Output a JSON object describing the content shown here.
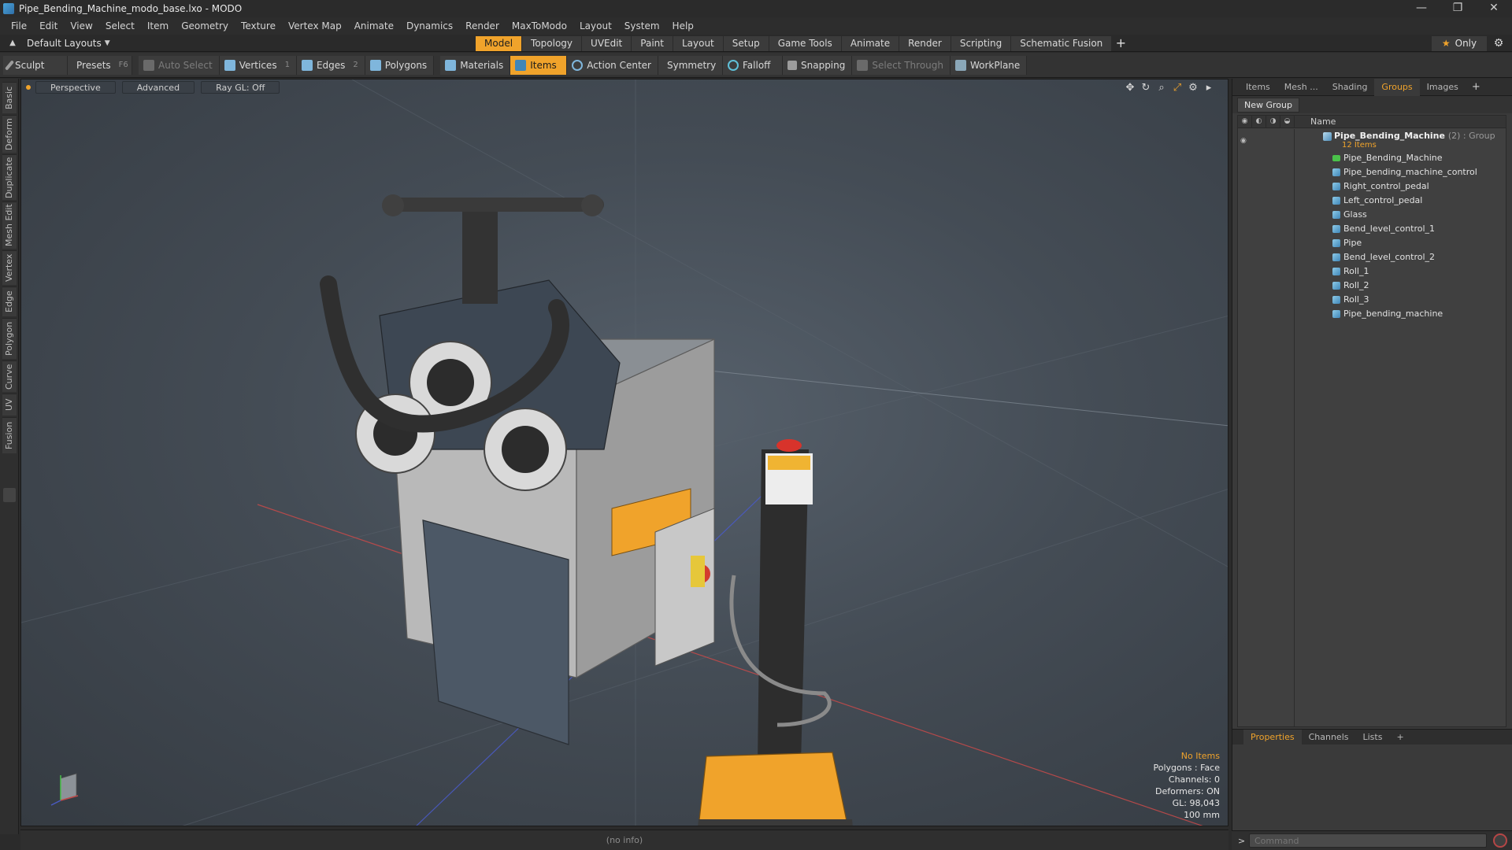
{
  "window": {
    "title": "Pipe_Bending_Machine_modo_base.lxo - MODO",
    "controls": [
      "—",
      "❐",
      "✕"
    ]
  },
  "menubar": [
    "File",
    "Edit",
    "View",
    "Select",
    "Item",
    "Geometry",
    "Texture",
    "Vertex Map",
    "Animate",
    "Dynamics",
    "Render",
    "MaxToModo",
    "Layout",
    "System",
    "Help"
  ],
  "layout": {
    "label": "Default Layouts"
  },
  "mode_tabs": [
    "Model",
    "Topology",
    "UVEdit",
    "Paint",
    "Layout",
    "Setup",
    "Game Tools",
    "Animate",
    "Render",
    "Scripting",
    "Schematic Fusion"
  ],
  "mode_active": "Model",
  "only_label": "Only",
  "toolbar": {
    "sculpt": "Sculpt",
    "presets": "Presets",
    "presets_key": "F6",
    "auto_select": "Auto Select",
    "vertices": "Vertices",
    "vertices_key": "1",
    "edges": "Edges",
    "edges_key": "2",
    "polygons": "Polygons",
    "materials": "Materials",
    "items": "Items",
    "action_center": "Action Center",
    "symmetry": "Symmetry",
    "falloff": "Falloff",
    "snapping": "Snapping",
    "select_through": "Select Through",
    "workplane": "WorkPlane"
  },
  "left_tabs": [
    "Basic",
    "Deform",
    "Duplicate",
    "Mesh Edit",
    "Vertex",
    "Edge",
    "Polygon",
    "Curve",
    "UV",
    "Fusion"
  ],
  "viewport": {
    "view": "Perspective",
    "shading": "Advanced",
    "raygl": "Ray GL: Off",
    "stats": {
      "selection": "No Items",
      "polygons": "Polygons : Face",
      "channels": "Channels: 0",
      "deformers": "Deformers: ON",
      "gl": "GL: 98,043",
      "unit": "100 mm"
    }
  },
  "right_panel": {
    "tabs": [
      "Items",
      "Mesh ...",
      "Shading",
      "Groups",
      "Images"
    ],
    "active_tab": "Groups",
    "new_group": "New Group",
    "name_header": "Name",
    "group": {
      "name": "Pipe_Bending_Machine",
      "meta": "(2) : Group",
      "count": "12 Items"
    },
    "items": [
      "Pipe_Bending_Machine",
      "Pipe_bending_machine_control",
      "Right_control_pedal",
      "Left_control_pedal",
      "Glass",
      "Bend_level_control_1",
      "Pipe",
      "Bend_level_control_2",
      "Roll_1",
      "Roll_2",
      "Roll_3",
      "Pipe_bending_machine"
    ],
    "bottom_tabs": [
      "Properties",
      "Channels",
      "Lists"
    ],
    "bottom_active": "Properties"
  },
  "status": {
    "info": "(no info)"
  },
  "command": {
    "placeholder": "Command"
  },
  "colors": {
    "accent": "#f0a32b",
    "panel": "#3a3a3a",
    "background": "#2b2b2b"
  }
}
